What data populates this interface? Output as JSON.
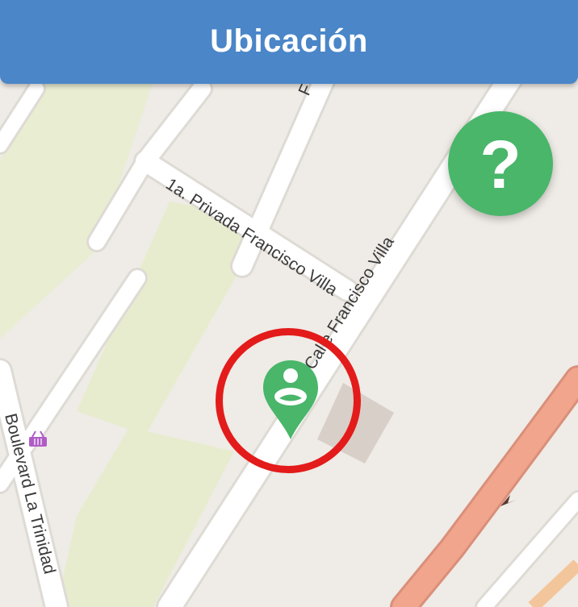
{
  "header": {
    "title": "Ubicación"
  },
  "help_button": {
    "label": "?",
    "icon": "help-icon",
    "color": "#49b66a"
  },
  "map": {
    "streets": {
      "privada": "1a. Privada Francisco Villa",
      "calle": "Calle Francisco Villa",
      "boulevard": "Boulevard La Trinidad",
      "top_fragment": "F"
    },
    "marker": {
      "icon": "user-location-pin-icon",
      "color": "#49b66a"
    },
    "highlight_color": "#e31b1b",
    "colors": {
      "land": "#efebe6",
      "park": "#e8eccf",
      "road": "#ffffff",
      "highway": "#f0a48c",
      "building": "#d9d0c9"
    }
  }
}
